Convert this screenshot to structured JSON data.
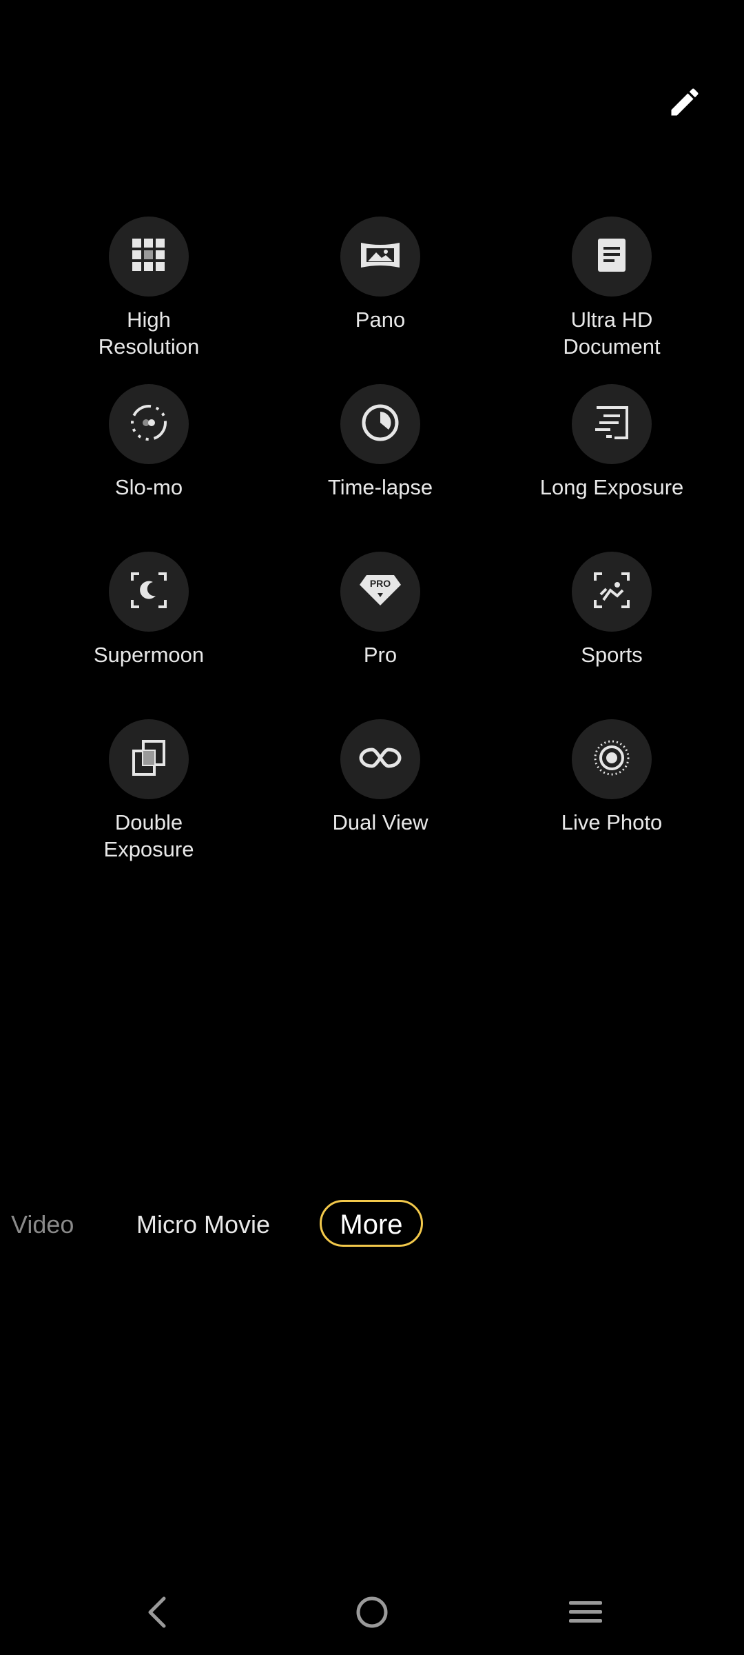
{
  "toolbar": {
    "edit_icon": "pencil-icon"
  },
  "modes": [
    {
      "label": "High\nResolution",
      "icon": "grid-icon"
    },
    {
      "label": "Pano",
      "icon": "panorama-icon"
    },
    {
      "label": "Ultra HD\nDocument",
      "icon": "document-icon"
    },
    {
      "label": "Slo-mo",
      "icon": "slow-motion-icon"
    },
    {
      "label": "Time-lapse",
      "icon": "timer-icon"
    },
    {
      "label": "Long Exposure",
      "icon": "long-exposure-icon"
    },
    {
      "label": "Supermoon",
      "icon": "moon-icon"
    },
    {
      "label": "Pro",
      "icon": "pro-diamond-icon"
    },
    {
      "label": "Sports",
      "icon": "sports-icon"
    },
    {
      "label": "Double\nExposure",
      "icon": "double-exposure-icon"
    },
    {
      "label": "Dual View",
      "icon": "dual-view-icon"
    },
    {
      "label": "Live Photo",
      "icon": "live-photo-icon"
    }
  ],
  "mode_bar": {
    "video": "Video",
    "micro_movie": "Micro Movie",
    "more": "More",
    "active": "More",
    "accent_color": "#f2c84b"
  },
  "navbar": {
    "back_icon": "back-icon",
    "home_icon": "home-icon",
    "menu_icon": "menu-icon"
  }
}
